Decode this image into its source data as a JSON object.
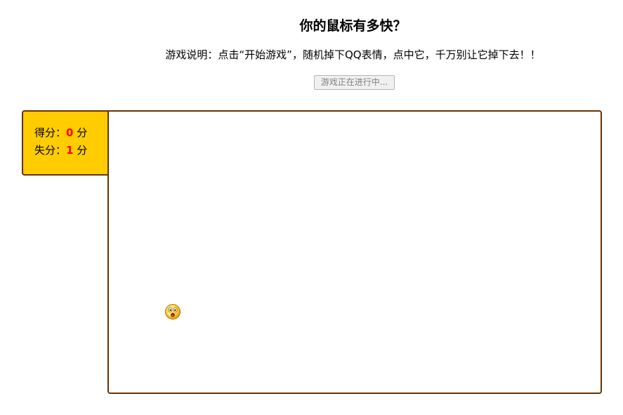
{
  "header": {
    "title": "你的鼠标有多快？",
    "instructions": "游戏说明：点击“开始游戏”，随机掉下QQ表情，点中它，千万别让它掉下去！！"
  },
  "controls": {
    "start_button_label": "游戏正在进行中..."
  },
  "scoreboard": {
    "score_label": "得分：",
    "score_value": "0",
    "miss_label": "失分：",
    "miss_value": "1",
    "unit": "分"
  },
  "game": {
    "falling_items": [
      {
        "icon": "qq-shocked-emoticon-icon"
      }
    ]
  },
  "colors": {
    "panel_background": "#ffcc00",
    "border": "#663300",
    "score_value": "#ff0000"
  }
}
